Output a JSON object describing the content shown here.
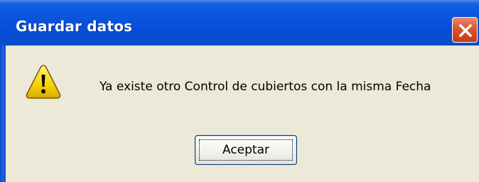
{
  "dialog": {
    "title": "Guardar datos",
    "message": "Ya existe otro Control de cubiertos con la misma Fecha",
    "ok_label": "Aceptar",
    "icon": "warning-icon",
    "close_icon": "close-icon"
  },
  "colors": {
    "titlebar": "#0a56dc",
    "body": "#ece9d8",
    "close_button": "#d9552f",
    "warning_fill": "#f5d300"
  }
}
